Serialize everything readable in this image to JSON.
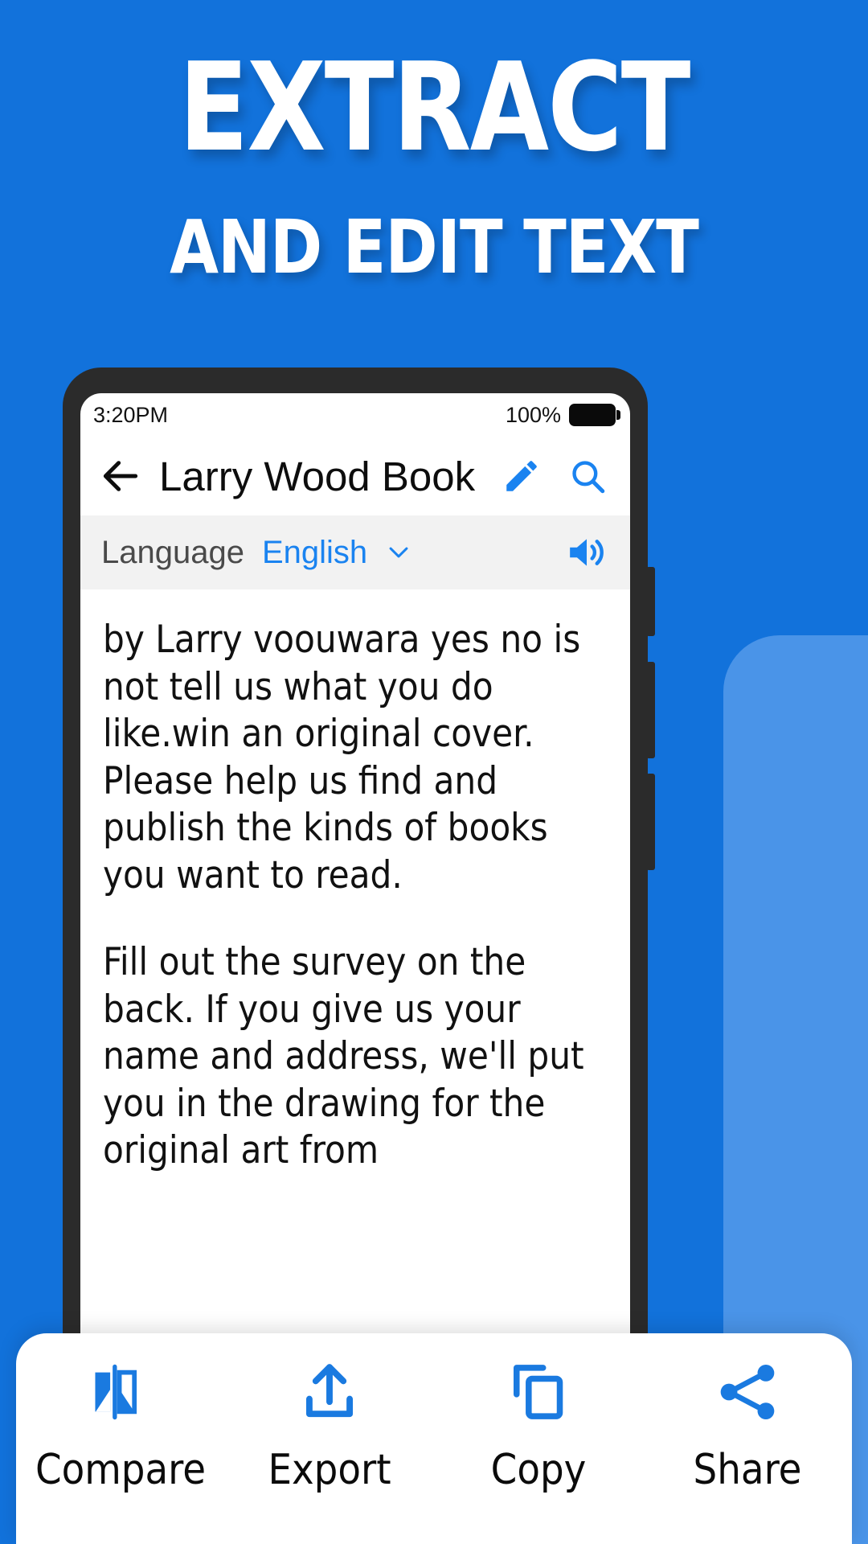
{
  "colors": {
    "background_blue": "#1272db",
    "accent_blue": "#1a83f0",
    "panel_blue": "#4a94e8",
    "bezel": "#2b2b2b",
    "langbar_bg": "#f2f2f2"
  },
  "promo": {
    "headline_line1": "EXTRACT",
    "headline_line2": "AND EDIT TEXT"
  },
  "phone": {
    "statusbar": {
      "time": "3:20PM",
      "battery_percent": "100%",
      "battery_icon": "battery-full-icon"
    },
    "appbar": {
      "back_icon": "back-arrow-icon",
      "title": "Larry Wood Book",
      "edit_icon": "pencil-icon",
      "search_icon": "search-icon"
    },
    "language_bar": {
      "label": "Language",
      "value": "English",
      "chevron_icon": "chevron-down-icon",
      "speaker_icon": "speaker-volume-icon"
    },
    "document": {
      "paragraph_1": "by Larry voouwara yes no is not tell us what you do like.win an original cover. Please help us find and publish the kinds of books you want to read.",
      "paragraph_2": "Fill out the survey on the back. If you give us your name and address, we'll put you in the drawing for the original art from"
    },
    "action_bar": {
      "items": [
        {
          "label": "Compare",
          "icon": "compare-flip-icon"
        },
        {
          "label": "Export",
          "icon": "export-upload-icon"
        },
        {
          "label": "Copy",
          "icon": "copy-duplicate-icon"
        },
        {
          "label": "Share",
          "icon": "share-nodes-icon"
        }
      ]
    }
  }
}
